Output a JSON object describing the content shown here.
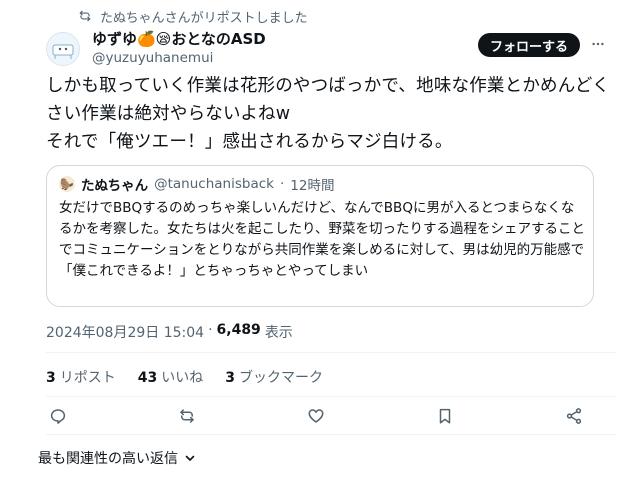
{
  "repost_banner": {
    "text": "たぬちゃんさんがリポストしました"
  },
  "author": {
    "display_name": "ゆずゆ🍊😪おとなのASD",
    "handle": "@yuzuyuhanemui"
  },
  "follow_button": {
    "label": "フォローする"
  },
  "tweet": {
    "text": "しかも取っていく作業は花形のやつばっかで、地味な作業とかめんどくさい作業は絶対やらないよねw\nそれで「俺ツエー！」感出されるからマジ白ける。"
  },
  "quote": {
    "avatar_emoji": "🦫",
    "name": "たぬちゃん",
    "handle": "@tanuchanisback",
    "separator": "·",
    "time": "12時間",
    "text": "女だけでBBQするのめっちゃ楽しいんだけど、なんでBBQに男が入るとつまらなくなるかを考察した。女たちは火を起こしたり、野菜を切ったりする過程をシェアすることでコミュニケーションをとりながら共同作業を楽しめるに対して、男は幼児的万能感で「僕これできるよ！」とちゃっちゃとやってしまい"
  },
  "meta": {
    "timestamp": "2024年08月29日 15:04",
    "separator": "·",
    "views_count": "6,489",
    "views_label": "表示"
  },
  "stats": {
    "reposts_count": "3",
    "reposts_label": "リポスト",
    "likes_count": "43",
    "likes_label": "いいね",
    "bookmarks_count": "3",
    "bookmarks_label": "ブックマーク"
  },
  "actions": [
    "reply-icon",
    "repost-icon",
    "like-icon",
    "bookmark-icon",
    "share-icon"
  ],
  "replies_sort": {
    "label": "最も関連性の高い返信"
  }
}
